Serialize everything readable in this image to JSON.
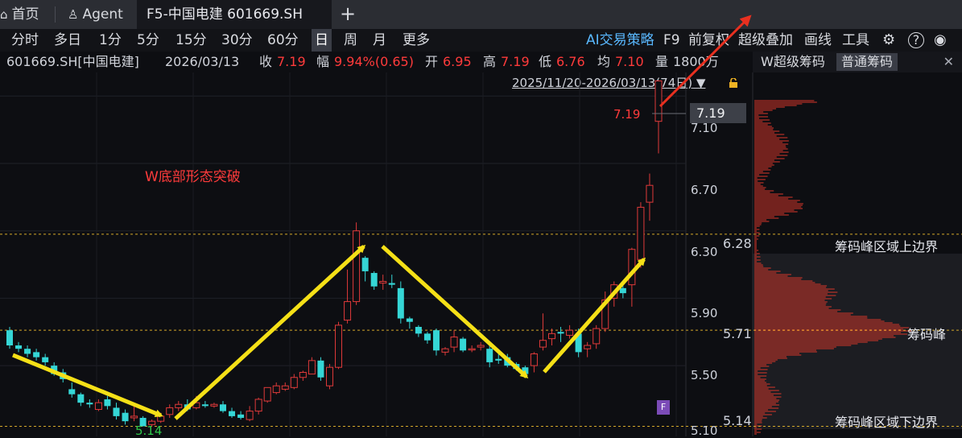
{
  "tabs": {
    "home": "首页",
    "agent": "Agent",
    "active": "F5-中国电建 601669.SH",
    "add": "+"
  },
  "periods": [
    "分时",
    "多日",
    "1分",
    "5分",
    "15分",
    "30分",
    "60分",
    "日",
    "周",
    "月",
    "更多"
  ],
  "selected_period": "日",
  "toolbar_right": {
    "ai": "AI交易策略",
    "f9": "F9",
    "fq": "前复权",
    "overlay": "超级叠加",
    "draw": "画线",
    "tools": "工具"
  },
  "quote": {
    "symbol": "601669.SH[中国电建]",
    "date": "2026/03/13",
    "close_label": "收",
    "close": "7.19",
    "change_label": "幅",
    "change": "9.94%(0.65)",
    "open_label": "开",
    "open": "6.95",
    "high_label": "高",
    "high": "7.19",
    "low_label": "低",
    "low": "6.76",
    "avg_label": "均",
    "avg": "7.10",
    "vol_label": "量",
    "vol": "1800万"
  },
  "range": "2025/11/20-2026/03/13(74日)",
  "right_panel": {
    "tab1": "W超级筹码",
    "tab2": "普通筹码",
    "close": "✕"
  },
  "annotation": "W底部形态突破",
  "current_price": "7.19",
  "high_marker": "7.19",
  "low_marker": "5.14",
  "y_ticks": [
    "7.10",
    "6.70",
    "6.30",
    "5.90",
    "5.50",
    "5.10"
  ],
  "chip_levels": {
    "upper": {
      "price": "6.28",
      "label": "筹码峰区域上边界"
    },
    "peak": {
      "price": "5.71",
      "label": "筹码峰"
    },
    "lower": {
      "price": "5.14",
      "label": "筹码峰区域下边界"
    }
  },
  "f_badge": "F",
  "colors": {
    "up": "#e03a3a",
    "down": "#35d6d6",
    "arrow": "#f5e017",
    "dashed": "#d4a92a"
  },
  "chart_data": {
    "type": "candlestick",
    "ylim": [
      5.08,
      7.24
    ],
    "candles": [
      [
        5.71,
        5.62,
        5.73,
        5.6
      ],
      [
        5.62,
        5.6,
        5.64,
        5.58
      ],
      [
        5.6,
        5.57,
        5.62,
        5.55
      ],
      [
        5.58,
        5.55,
        5.6,
        5.53
      ],
      [
        5.55,
        5.52,
        5.57,
        5.5
      ],
      [
        5.5,
        5.45,
        5.52,
        5.44
      ],
      [
        5.46,
        5.42,
        5.48,
        5.4
      ],
      [
        5.36,
        5.33,
        5.4,
        5.31
      ],
      [
        5.33,
        5.28,
        5.34,
        5.26
      ],
      [
        5.28,
        5.27,
        5.3,
        5.25
      ],
      [
        5.24,
        5.28,
        5.3,
        5.23
      ],
      [
        5.3,
        5.26,
        5.32,
        5.24
      ],
      [
        5.25,
        5.2,
        5.28,
        5.18
      ],
      [
        5.22,
        5.17,
        5.24,
        5.15
      ],
      [
        5.19,
        5.2,
        5.26,
        5.17
      ],
      [
        5.19,
        5.14,
        5.2,
        5.14
      ],
      [
        5.15,
        5.17,
        5.18,
        5.14
      ],
      [
        5.17,
        5.2,
        5.22,
        5.16
      ],
      [
        5.21,
        5.25,
        5.27,
        5.19
      ],
      [
        5.25,
        5.27,
        5.29,
        5.23
      ],
      [
        5.27,
        5.24,
        5.3,
        5.23
      ],
      [
        5.25,
        5.28,
        5.32,
        5.24
      ],
      [
        5.27,
        5.26,
        5.29,
        5.25
      ],
      [
        5.26,
        5.27,
        5.28,
        5.25
      ],
      [
        5.27,
        5.23,
        5.29,
        5.22
      ],
      [
        5.23,
        5.2,
        5.25,
        5.19
      ],
      [
        5.21,
        5.19,
        5.23,
        5.18
      ],
      [
        5.18,
        5.23,
        5.26,
        5.17
      ],
      [
        5.23,
        5.3,
        5.31,
        5.21
      ],
      [
        5.29,
        5.37,
        5.37,
        5.28
      ],
      [
        5.34,
        5.38,
        5.4,
        5.33
      ],
      [
        5.36,
        5.38,
        5.4,
        5.35
      ],
      [
        5.37,
        5.43,
        5.45,
        5.36
      ],
      [
        5.43,
        5.46,
        5.47,
        5.41
      ],
      [
        5.45,
        5.53,
        5.55,
        5.45
      ],
      [
        5.53,
        5.43,
        5.55,
        5.41
      ],
      [
        5.38,
        5.49,
        5.51,
        5.36
      ],
      [
        5.49,
        5.74,
        5.76,
        5.48
      ],
      [
        5.77,
        5.88,
        6.07,
        5.75
      ],
      [
        5.88,
        6.3,
        6.35,
        5.86
      ],
      [
        6.14,
        6.06,
        6.15,
        6.0
      ],
      [
        6.05,
        5.97,
        6.06,
        5.95
      ],
      [
        5.99,
        6.0,
        6.04,
        5.95
      ],
      [
        5.99,
        5.98,
        6.04,
        5.96
      ],
      [
        5.96,
        5.78,
        6.0,
        5.75
      ],
      [
        5.78,
        5.76,
        5.79,
        5.72
      ],
      [
        5.73,
        5.69,
        5.74,
        5.67
      ],
      [
        5.69,
        5.65,
        5.7,
        5.63
      ],
      [
        5.71,
        5.59,
        5.72,
        5.56
      ],
      [
        5.58,
        5.6,
        5.61,
        5.56
      ],
      [
        5.61,
        5.67,
        5.71,
        5.58
      ],
      [
        5.66,
        5.59,
        5.67,
        5.58
      ],
      [
        5.6,
        5.6,
        5.62,
        5.58
      ],
      [
        5.61,
        5.62,
        5.64,
        5.59
      ],
      [
        5.6,
        5.52,
        5.63,
        5.49
      ],
      [
        5.54,
        5.53,
        5.57,
        5.51
      ],
      [
        5.55,
        5.5,
        5.57,
        5.49
      ],
      [
        5.51,
        5.48,
        5.52,
        5.47
      ],
      [
        5.49,
        5.45,
        5.5,
        5.44
      ],
      [
        5.5,
        5.57,
        5.58,
        5.46
      ],
      [
        5.61,
        5.65,
        5.81,
        5.59
      ],
      [
        5.66,
        5.69,
        5.72,
        5.62
      ],
      [
        5.7,
        5.69,
        5.73,
        5.64
      ],
      [
        5.68,
        5.71,
        5.74,
        5.66
      ],
      [
        5.69,
        5.58,
        5.72,
        5.55
      ],
      [
        5.6,
        5.62,
        5.64,
        5.55
      ],
      [
        5.63,
        5.72,
        5.74,
        5.6
      ],
      [
        5.72,
        5.89,
        5.94,
        5.7
      ],
      [
        5.9,
        5.98,
        6.0,
        5.85
      ],
      [
        5.96,
        5.93,
        5.98,
        5.9
      ],
      [
        5.98,
        6.19,
        6.2,
        5.85
      ],
      [
        6.13,
        6.44,
        6.47,
        6.08
      ],
      [
        6.47,
        6.57,
        6.64,
        6.36
      ],
      [
        6.95,
        7.19,
        7.19,
        6.76
      ]
    ]
  }
}
